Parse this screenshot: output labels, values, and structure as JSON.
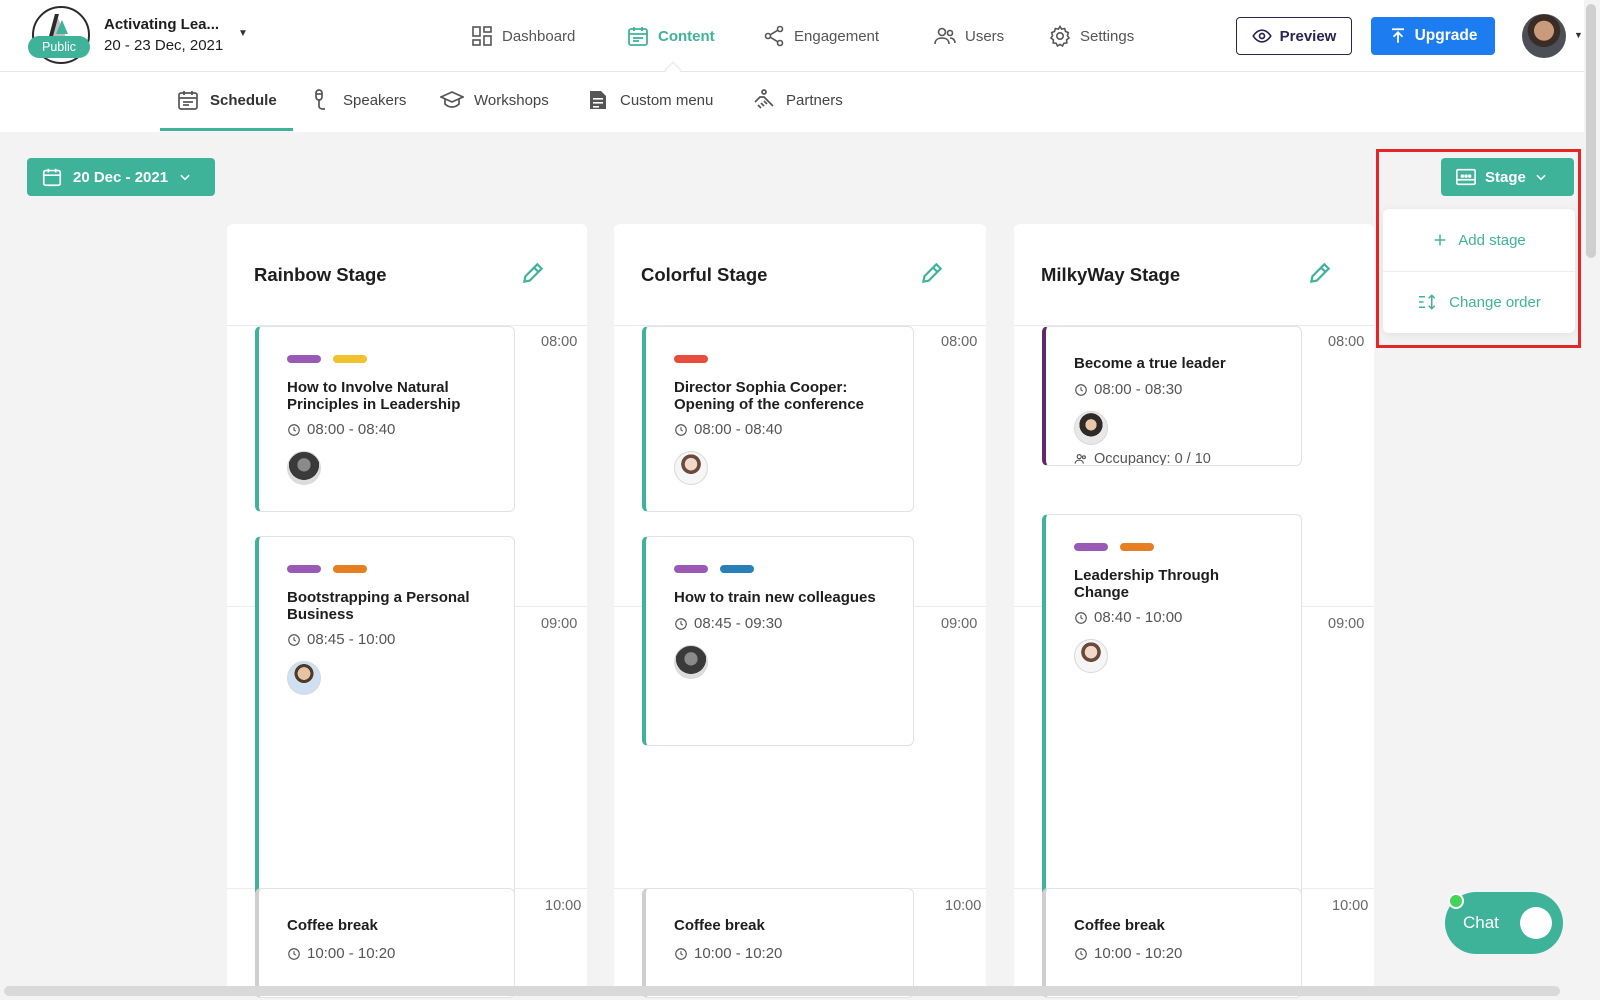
{
  "header": {
    "event_name": "Activating Lea...",
    "event_dates": "20 - 23 Dec, 2021",
    "visibility_badge": "Public",
    "nav": [
      {
        "label": "Dashboard",
        "icon": "dashboard-icon"
      },
      {
        "label": "Content",
        "icon": "calendar-icon",
        "active": true
      },
      {
        "label": "Engagement",
        "icon": "share-icon"
      },
      {
        "label": "Users",
        "icon": "users-icon"
      },
      {
        "label": "Settings",
        "icon": "gear-icon"
      }
    ],
    "preview_label": "Preview",
    "upgrade_label": "Upgrade"
  },
  "subnav": {
    "tabs": [
      {
        "label": "Schedule",
        "icon": "schedule-icon",
        "active": true
      },
      {
        "label": "Speakers",
        "icon": "microphone-icon"
      },
      {
        "label": "Workshops",
        "icon": "graduation-cap-icon"
      },
      {
        "label": "Custom menu",
        "icon": "document-icon"
      },
      {
        "label": "Partners",
        "icon": "handshake-icon"
      }
    ]
  },
  "toolbar": {
    "date_label": "20 Dec - 2021",
    "stage_label": "Stage",
    "menu": {
      "add_stage": "Add stage",
      "change_order": "Change order"
    }
  },
  "times": [
    "08:00",
    "09:00",
    "10:00"
  ],
  "stages": [
    {
      "title": "Rainbow Stage",
      "sessions": [
        {
          "title": "How to Involve Natural Principles in Leadership",
          "time": "08:00 - 08:40",
          "tags": [
            "#9b59b6",
            "#f2c12e"
          ]
        },
        {
          "title": "Bootstrapping a Personal Business",
          "time": "08:45 - 10:00",
          "tags": [
            "#9b59b6",
            "#e67e22"
          ]
        },
        {
          "title": "Coffee break",
          "time": "10:00 - 10:20"
        }
      ]
    },
    {
      "title": "Colorful Stage",
      "sessions": [
        {
          "title": "Director Sophia Cooper: Opening of the conference",
          "time": "08:00 - 08:40",
          "tags": [
            "#e74c3c"
          ]
        },
        {
          "title": "How to train new colleagues",
          "time": "08:45 - 09:30",
          "tags": [
            "#9b59b6",
            "#2980b9"
          ]
        },
        {
          "title": "Coffee break",
          "time": "10:00 - 10:20"
        }
      ]
    },
    {
      "title": "MilkyWay Stage",
      "sessions": [
        {
          "title": "Become a true leader",
          "time": "08:00 - 08:30",
          "occupancy": "Occupancy: 0 / 10"
        },
        {
          "title": "Leadership Through Change",
          "time": "08:40 - 10:00",
          "tags": [
            "#9b59b6",
            "#e67e22"
          ]
        },
        {
          "title": "Coffee break",
          "time": "10:00 - 10:20"
        }
      ]
    }
  ],
  "chat_label": "Chat",
  "colors": {
    "accent": "#3fb39a",
    "upgrade": "#1c7cf0",
    "highlight": "#e32626"
  }
}
